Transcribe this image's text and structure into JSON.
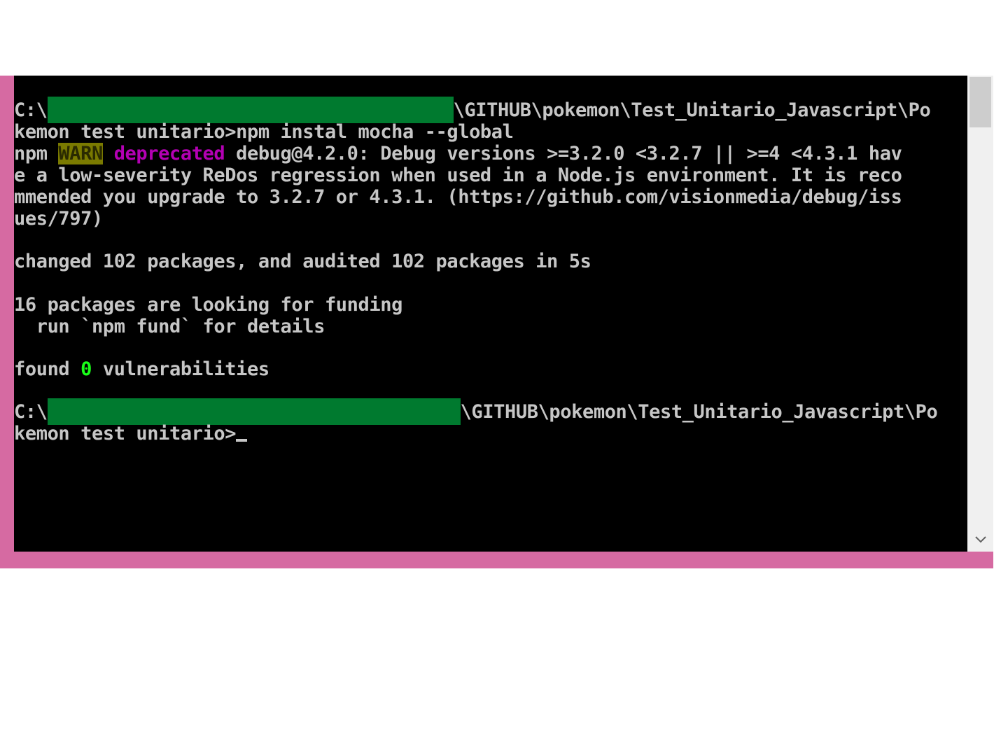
{
  "console": {
    "lines": {
      "l1a": "C:\\",
      "l1b": "\\GITHUB\\pokemon\\Test_Unitario_Javascript\\Po",
      "l2": "kemon test unitario>npm instal mocha --global",
      "l3a": "npm ",
      "l3warn": "WARN",
      "l3dep": "deprecated",
      "l3b": " debug@4.2.0: Debug versions >=3.2.0 <3.2.7 || >=4 <4.3.1 hav",
      "l4": "e a low-severity ReDos regression when used in a Node.js environment. It is reco",
      "l5": "mmended you upgrade to 3.2.7 or 4.3.1. (https://github.com/visionmedia/debug/iss",
      "l6": "ues/797)",
      "l8": "changed 102 packages, and audited 102 packages in 5s",
      "l10": "16 packages are looking for funding",
      "l11": "  run `npm fund` for details",
      "l13a": "found ",
      "l13zero": "0",
      "l13b": " vulnerabilities",
      "l15a": "C:\\",
      "l15b": "\\GITHUB\\pokemon\\Test_Unitario_Javascript\\Po",
      "l16": "kemon test unitario>"
    },
    "colors": {
      "background": "#000000",
      "text": "#c6c6c6",
      "warn_bg": "#7a7a00",
      "deprecated": "#b400b4",
      "success": "#19ff19",
      "redaction": "#007a2f",
      "frame": "#d66aa2"
    }
  },
  "scrollbar": {
    "down_icon": "chevron-down-icon"
  }
}
